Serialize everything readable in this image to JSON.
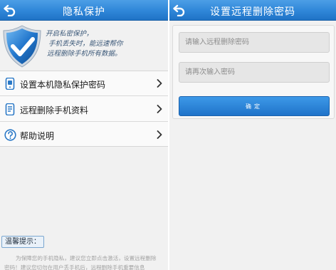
{
  "left_screen": {
    "title": "隐私保护",
    "slogan": [
      "开启私密保护，",
      "手机丢失时，能远速帮你",
      "远程删除手机所有数据。"
    ],
    "menu": [
      {
        "label": "设置本机隐私保护密码",
        "icon": "phone-icon"
      },
      {
        "label": "远程删除手机资料",
        "icon": "remote-delete-icon"
      },
      {
        "label": "帮助说明",
        "icon": "help-icon"
      }
    ],
    "tip_title": "温馨提示：",
    "tip_lines": [
      "为保障您的手机隐私，建议您立即点击激活，设置远程删除",
      "密码！建议您切勿在用户丢手机后，远程删除手机重要信息"
    ]
  },
  "right_screen": {
    "title": "设置远程删除密码",
    "password_placeholder": "请输入远程删除密码",
    "confirm_placeholder": "请再次输入密码",
    "confirm_button": "确定"
  },
  "colors": {
    "titlebar": "#2f86d8",
    "button": "#2a86d8",
    "background": "#f1f1f1"
  }
}
